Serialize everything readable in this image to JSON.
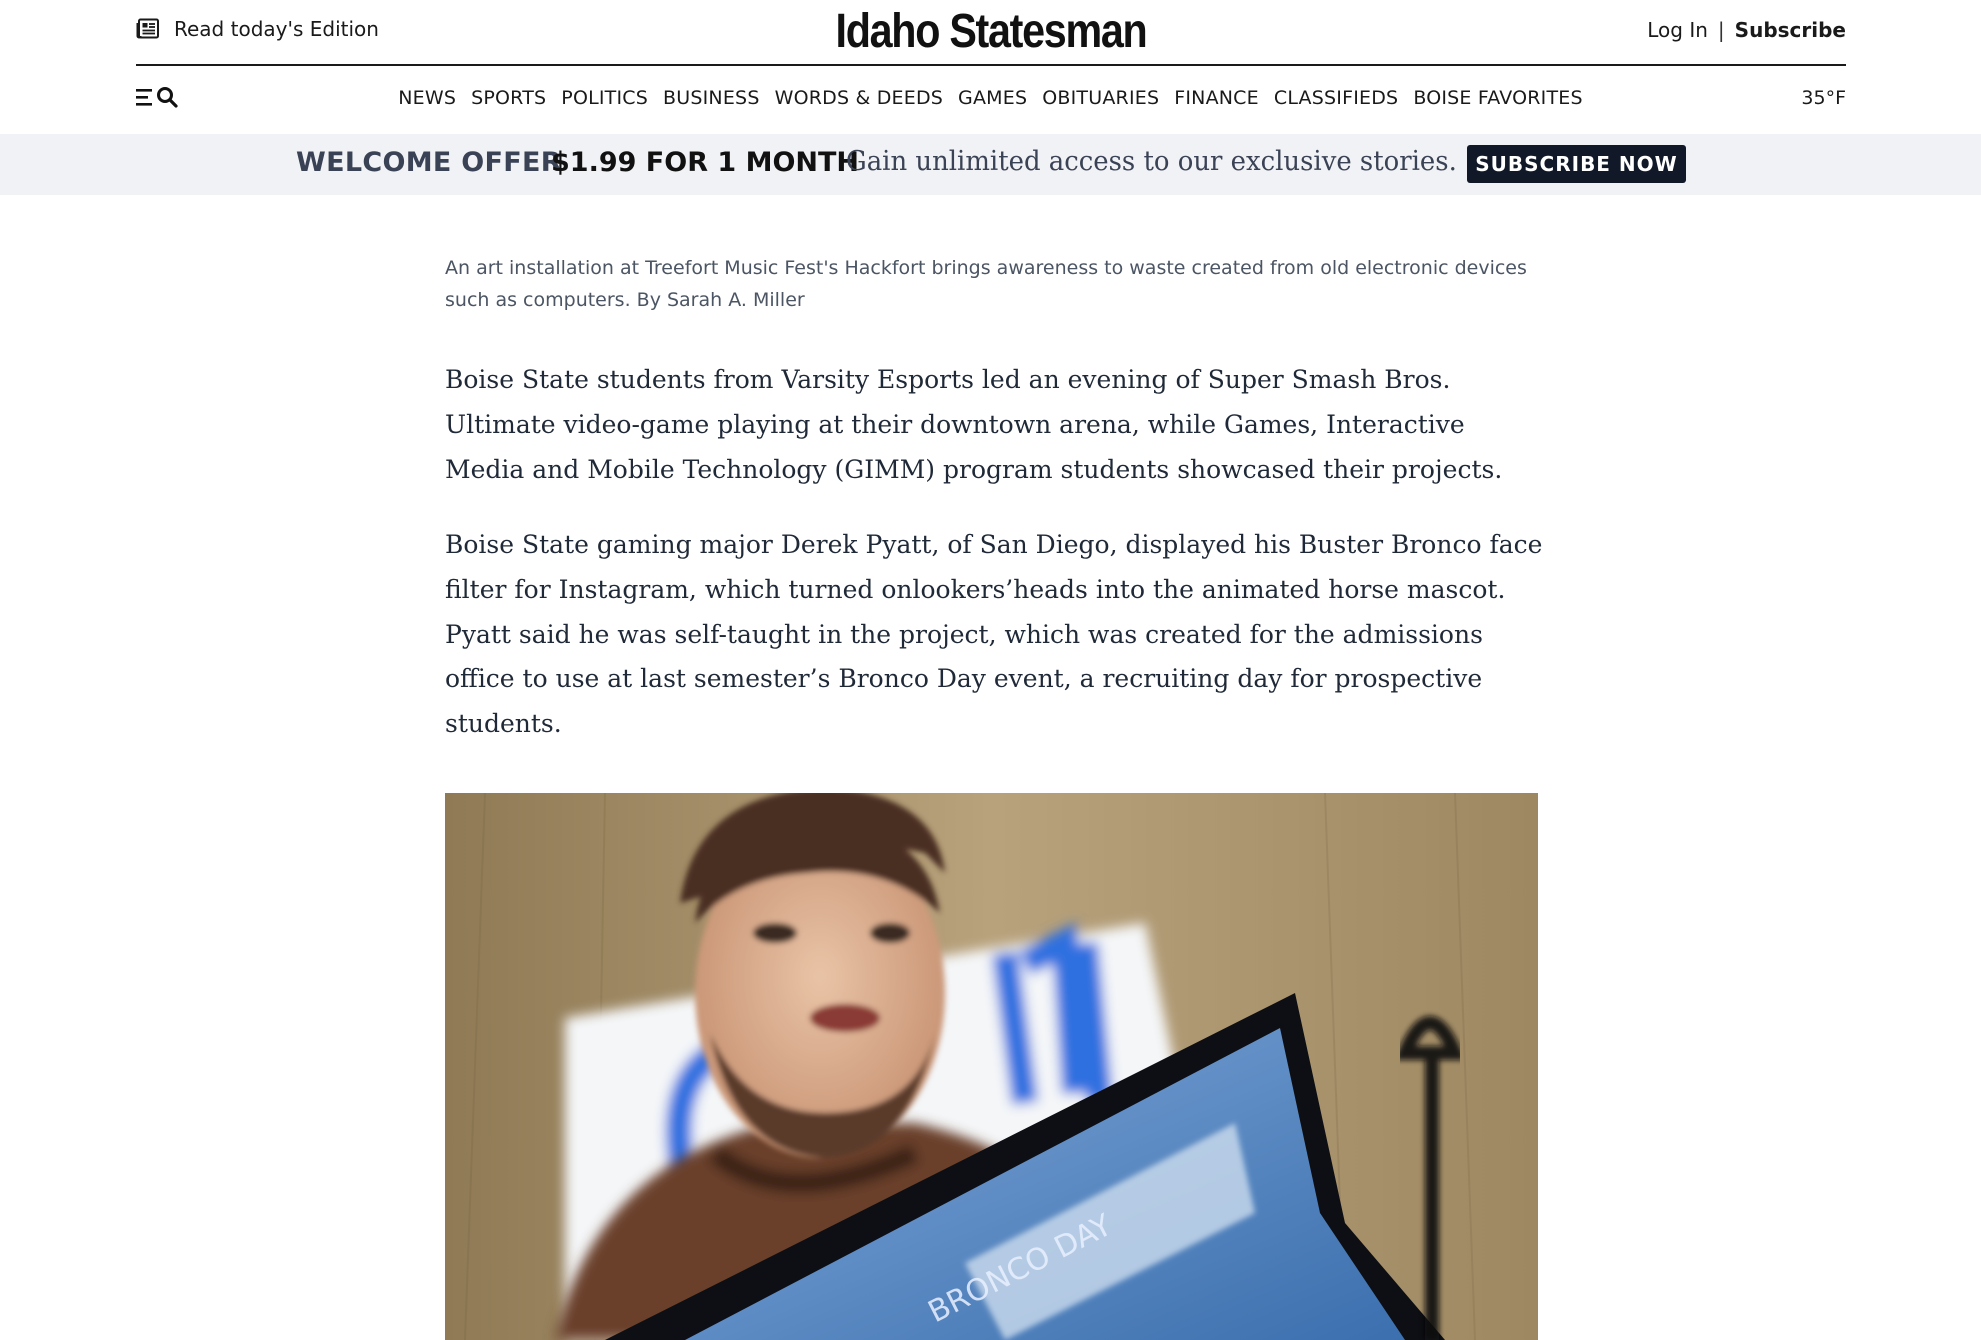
{
  "header": {
    "edition_label": "Read today's Edition",
    "logo": "Idaho Statesman",
    "login_label": "Log In",
    "separator": "|",
    "subscribe_label": "Subscribe"
  },
  "nav": {
    "items": [
      "NEWS",
      "SPORTS",
      "POLITICS",
      "BUSINESS",
      "WORDS & DEEDS",
      "GAMES",
      "OBITUARIES",
      "FINANCE",
      "CLASSIFIEDS",
      "BOISE FAVORITES"
    ],
    "temperature": "35°F"
  },
  "offer": {
    "welcome": "WELCOME OFFER",
    "price": "$1.99 FOR 1 MONTH",
    "tagline": "Gain unlimited access to our exclusive stories.",
    "button_label": "SUBSCRIBE NOW"
  },
  "article": {
    "caption": "An art installation at Treefort Music Fest's Hackfort brings awareness to waste created from old electronic devices such as computers. By Sarah A. Miller",
    "paragraphs": [
      "Boise State students from Varsity Esports led an evening of Super Smash Bros. Ultimate video-game playing at their downtown arena, while Games, Interactive Media and Mobile Technology (GIMM) program students showcased their projects.",
      "Boise State gaming major Derek Pyatt, of San Diego, displayed his Buster Bronco face filter for Instagram, which turned onlookers’heads into the animated horse mascot. Pyatt said he was self-taught in the project, which was created for the admissions office to use at last semester’s Bronco Day event, a recruiting day for prospective students."
    ],
    "photo": {
      "sign_text": "GIMM",
      "screen_text": "BRONCO DAY"
    }
  },
  "colors": {
    "offer_background": "#f1f2f5",
    "offer_text": "#3a4255",
    "button_background": "#111827",
    "sign_blue": "#2f6fe0"
  }
}
